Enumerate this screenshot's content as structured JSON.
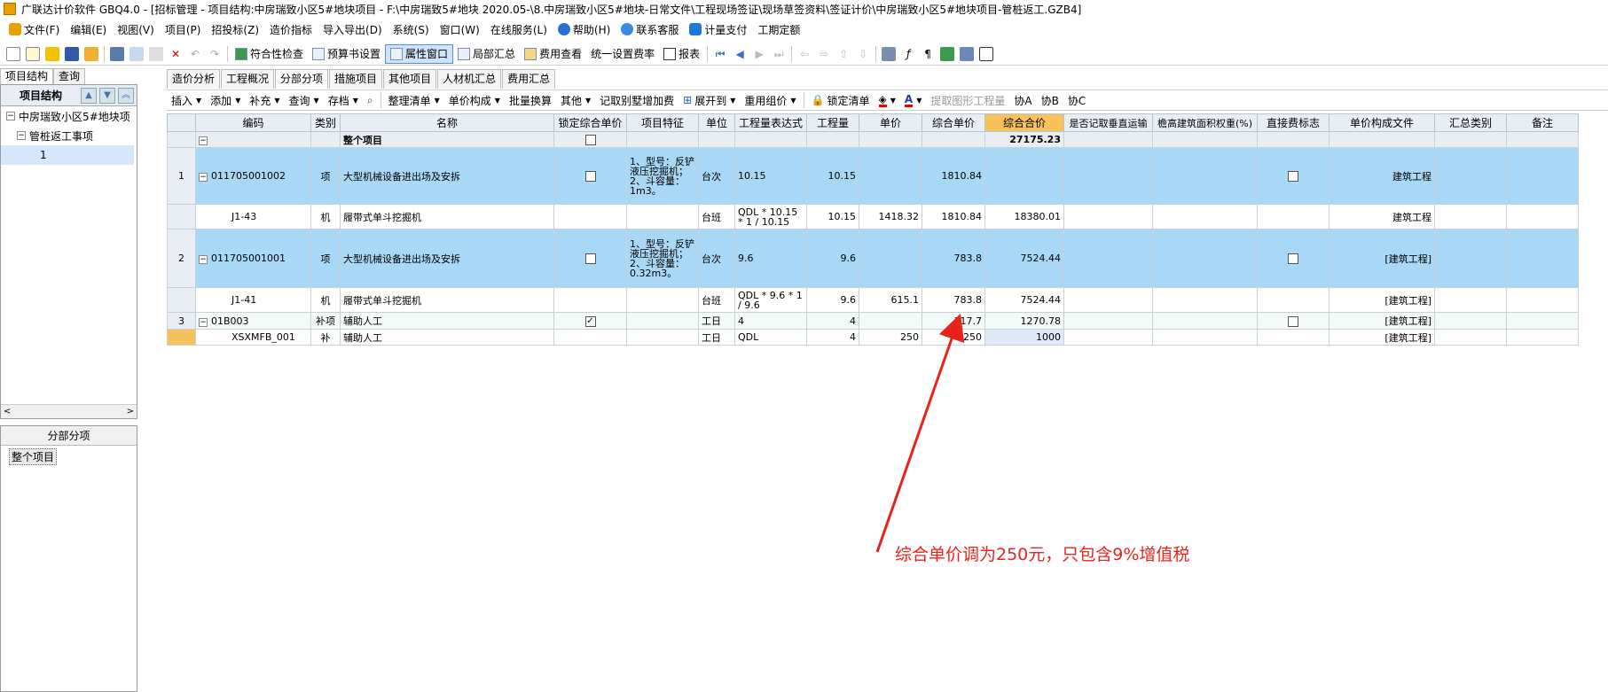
{
  "window": {
    "title": "广联达计价软件 GBQ4.0 - [招标管理 - 项目结构:中房瑞致小区5#地块项目 - F:\\中房瑞致5#地块 2020.05-\\8.中房瑞致小区5#地块-日常文件\\工程现场签证\\现场草签资料\\签证计价\\中房瑞致小区5#地块项目-管桩返工.GZB4]"
  },
  "menu": [
    {
      "label": "文件(F)"
    },
    {
      "label": "编辑(E)"
    },
    {
      "label": "视图(V)"
    },
    {
      "label": "项目(P)"
    },
    {
      "label": "招投标(Z)"
    },
    {
      "label": "造价指标"
    },
    {
      "label": "导入导出(D)"
    },
    {
      "label": "系统(S)"
    },
    {
      "label": "窗口(W)"
    },
    {
      "label": "在线服务(L)"
    },
    {
      "label": "帮助(H)"
    },
    {
      "label": "联系客服"
    },
    {
      "label": "计量支付"
    },
    {
      "label": "工期定额"
    }
  ],
  "toolbar": {
    "check": "符合性检查",
    "budget": "预算书设置",
    "property_window": "属性窗口",
    "local_summary": "局部汇总",
    "fee_view": "费用查看",
    "unify_rate": "统一设置费率",
    "report": "报表"
  },
  "left": {
    "tabs": [
      "项目结构",
      "查询"
    ],
    "tree_header": "项目结构",
    "tree": {
      "root": "中房瑞致小区5#地块项",
      "child": "管桩返工事项",
      "leaf": "1"
    },
    "sub_header": "分部分项",
    "sub_item": "整个项目"
  },
  "main_tabs": [
    "造价分析",
    "工程概况",
    "分部分项",
    "措施项目",
    "其他项目",
    "人材机汇总",
    "费用汇总"
  ],
  "sub_toolbar": [
    {
      "label": "插入"
    },
    {
      "label": "添加"
    },
    {
      "label": "补充"
    },
    {
      "label": "查询"
    },
    {
      "label": "存档"
    },
    {
      "label": "整理清单"
    },
    {
      "label": "单价构成"
    },
    {
      "label": "批量换算"
    },
    {
      "label": "其他"
    },
    {
      "label": "记取别墅增加费"
    },
    {
      "label": "展开到"
    },
    {
      "label": "重用组价"
    },
    {
      "label": "锁定清单"
    },
    {
      "label": "提取图形工程量"
    },
    {
      "label": "协A"
    },
    {
      "label": "协B"
    },
    {
      "label": "协C"
    }
  ],
  "grid": {
    "headers": [
      "编码",
      "类别",
      "名称",
      "锁定综合单价",
      "项目特征",
      "单位",
      "工程量表达式",
      "工程量",
      "单价",
      "综合单价",
      "综合合价",
      "是否记取垂直运输",
      "檐高建筑面积权重(%)",
      "直接费标志",
      "单价构成文件",
      "汇总类别",
      "备注"
    ],
    "total_row": {
      "name": "整个项目",
      "total": "27175.23"
    },
    "rows": [
      {
        "rn": "1",
        "code": "011705001002",
        "type": "项",
        "name": "大型机械设备进出场及安拆",
        "feature": "1、型号：反铲液压挖掘机；2、斗容量：1m3。",
        "unit": "台次",
        "expr": "10.15",
        "qty": "10.15",
        "price": "",
        "unit_total": "1810.84",
        "total": "",
        "file": "建筑工程"
      },
      {
        "rn": "",
        "code": "J1-43",
        "type": "机",
        "name": "履带式单斗挖掘机",
        "feature": "",
        "unit": "台班",
        "expr": "QDL * 10.15 * 1 / 10.15",
        "qty": "10.15",
        "price": "1418.32",
        "unit_total": "1810.84",
        "total": "18380.01",
        "file": "建筑工程"
      },
      {
        "rn": "2",
        "code": "011705001001",
        "type": "项",
        "name": "大型机械设备进出场及安拆",
        "feature": "1、型号：反铲液压挖掘机；2、斗容量：0.32m3。",
        "unit": "台次",
        "expr": "9.6",
        "qty": "9.6",
        "price": "",
        "unit_total": "783.8",
        "total": "7524.44",
        "file": "[建筑工程]"
      },
      {
        "rn": "",
        "code": "J1-41",
        "type": "机",
        "name": "履带式单斗挖掘机",
        "feature": "",
        "unit": "台班",
        "expr": "QDL * 9.6 * 1 / 9.6",
        "qty": "9.6",
        "price": "615.1",
        "unit_total": "783.8",
        "total": "7524.44",
        "file": "[建筑工程]"
      },
      {
        "rn": "3",
        "code": "01B003",
        "type": "补项",
        "name": "辅助人工",
        "feature": "",
        "unit": "工日",
        "expr": "4",
        "qty": "4",
        "price": "",
        "unit_total": "317.7",
        "total": "1270.78",
        "file": "[建筑工程]"
      },
      {
        "rn": "",
        "code": "XSXMFB_001",
        "type": "补",
        "name": "辅助人工",
        "feature": "",
        "unit": "工日",
        "expr": "QDL",
        "qty": "4",
        "price": "250",
        "unit_total": "250",
        "total": "1000",
        "file": "[建筑工程]"
      }
    ]
  },
  "annotation": "综合单价调为250元，只包含9%增值税",
  "colors": {
    "annotation": "#e8231c",
    "selected_row": "#a8d8f5",
    "highlight_header": "#f6c35a"
  }
}
